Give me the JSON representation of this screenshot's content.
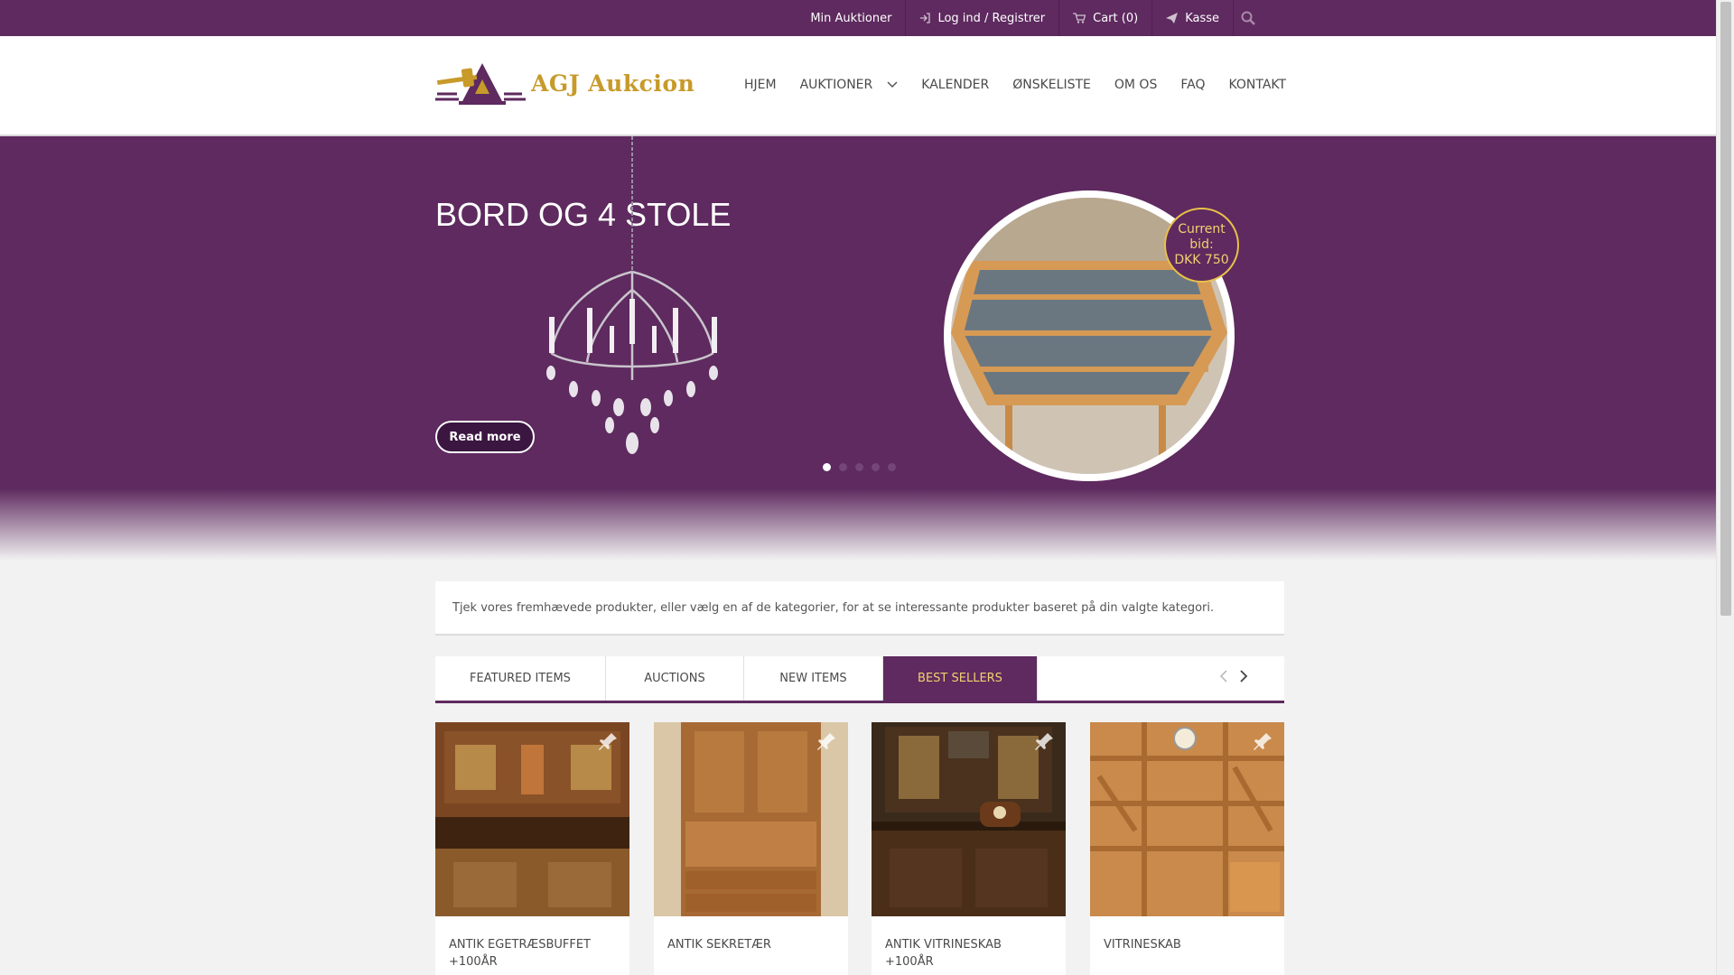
{
  "topbar": {
    "links": [
      {
        "label": "Min Auktioner",
        "icon": ""
      },
      {
        "label": "Log ind / Registrer",
        "icon": "login-icon"
      },
      {
        "label": "Cart (0)",
        "icon": "cart-icon"
      },
      {
        "label": "Kasse",
        "icon": "send-icon"
      }
    ],
    "search_icon": "search-icon"
  },
  "header": {
    "logo_text": "AGJ Aukcion",
    "nav": [
      "HJEM",
      "AUKTIONER",
      "KALENDER",
      "ØNSKELISTE",
      "OM OS",
      "FAQ",
      "KONTAKT"
    ]
  },
  "hero": {
    "title": "BORD OG 4 STOLE",
    "read_more": "Read more",
    "bid_line1": "Current",
    "bid_line2": "bid:",
    "bid_line3": "DKK 750",
    "slides": 5,
    "active_slide": 1
  },
  "intro": {
    "text": "Tjek vores fremhævede produkter, eller vælg en af de kategorier, for at se interessante produkter baseret på din valgte kategori."
  },
  "tabs": {
    "items": [
      "FEATURED ITEMS",
      "AUCTIONS",
      "NEW ITEMS",
      "BEST SELLERS"
    ],
    "active": "BEST SELLERS"
  },
  "products": [
    {
      "name": "ANTIK EGETRÆSBUFFET +100ÅR"
    },
    {
      "name": "ANTIK SEKRETÆR"
    },
    {
      "name": "ANTIK VITRINESKAB +100ÅR"
    },
    {
      "name": "VITRINESKAB"
    }
  ],
  "colors": {
    "brand_purple": "#5e2a5f",
    "accent_gold": "#c79a2a",
    "tab_active_text": "#f2d071"
  }
}
